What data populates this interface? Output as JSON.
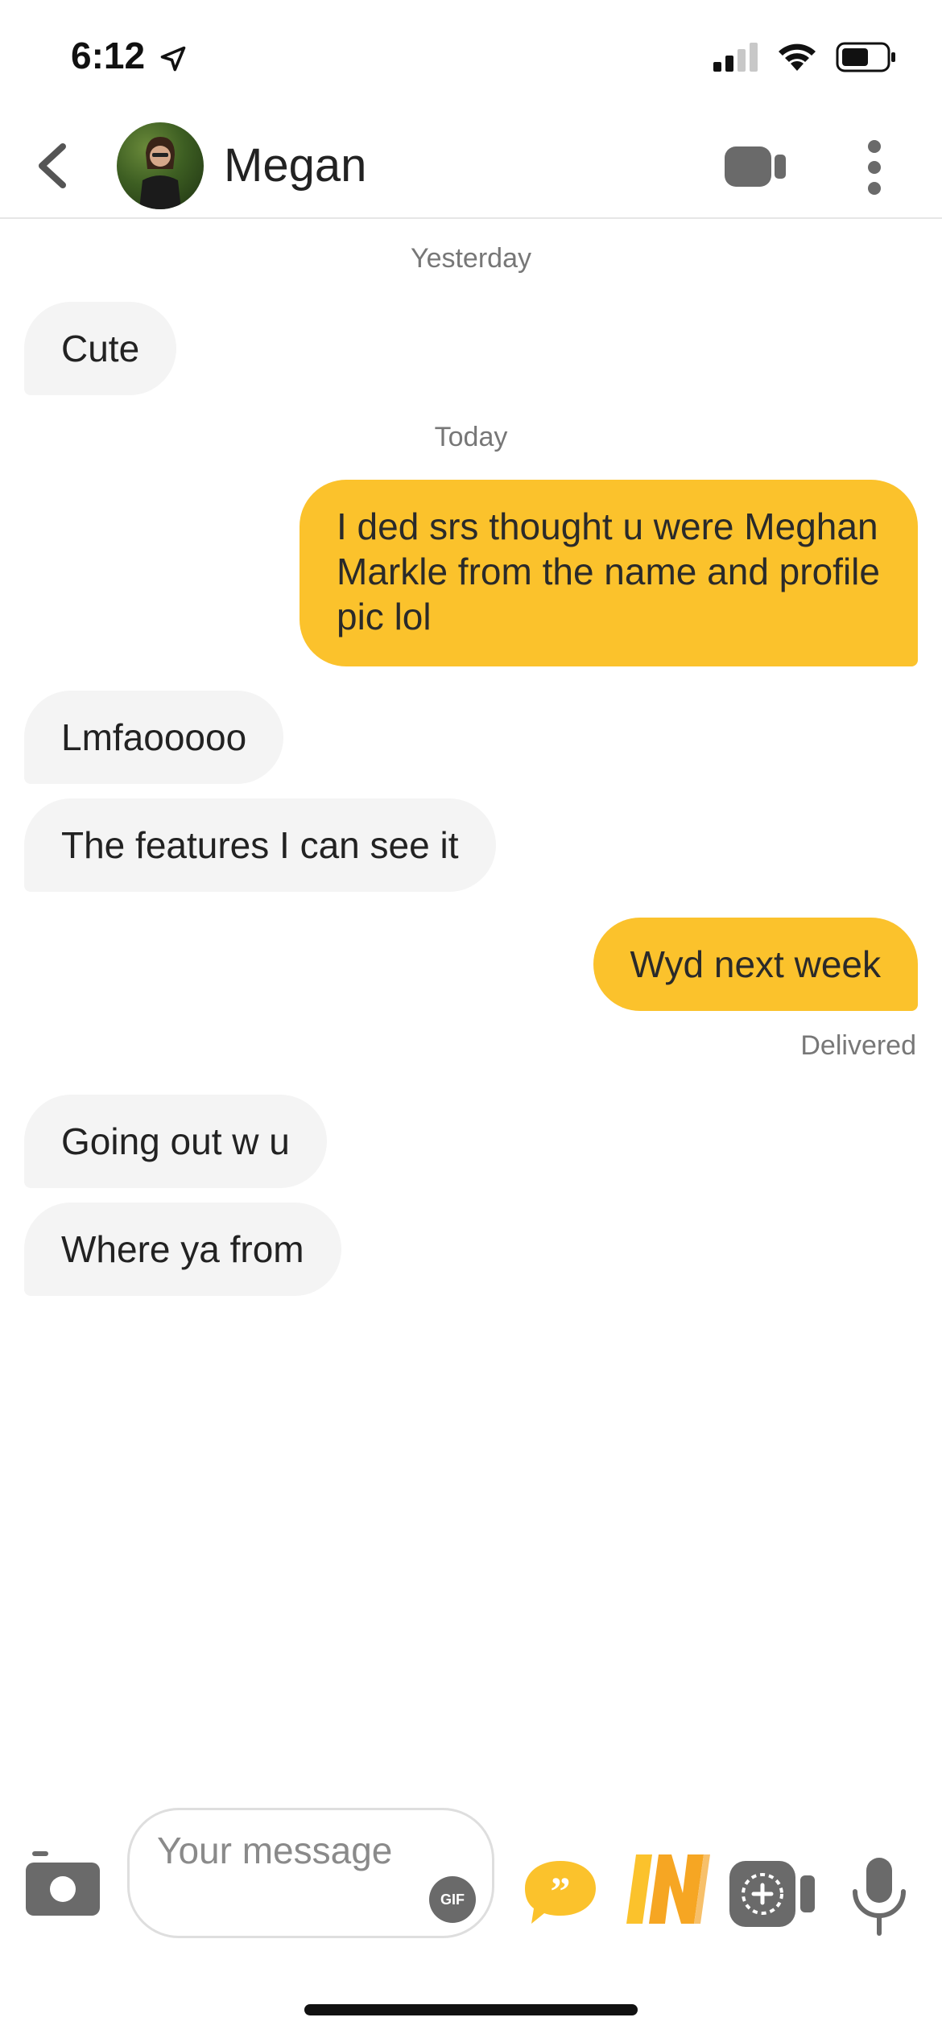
{
  "status_bar": {
    "time": "6:12"
  },
  "header": {
    "contact_name": "Megan"
  },
  "messages": [
    {
      "type": "date",
      "text": "Yesterday"
    },
    {
      "type": "in",
      "text": "Cute"
    },
    {
      "type": "date",
      "text": "Today"
    },
    {
      "type": "out",
      "text": "I ded srs thought u were Meghan Markle from the name and profile pic lol"
    },
    {
      "type": "in",
      "text": "Lmfaooooo"
    },
    {
      "type": "in",
      "text": "The features I can see it"
    },
    {
      "type": "out",
      "text": "Wyd next week"
    },
    {
      "type": "status",
      "text": "Delivered"
    },
    {
      "type": "in",
      "text": "Going out w u"
    },
    {
      "type": "in",
      "text": "Where ya from"
    }
  ],
  "composer": {
    "placeholder": "Your message",
    "gif_label": "GIF"
  },
  "colors": {
    "accent": "#fbc22c",
    "incoming_bubble": "#f4f4f4",
    "icon_gray": "#6a6a6a"
  },
  "icons": [
    "location-arrow-icon",
    "cellular-icon",
    "wifi-icon",
    "battery-icon",
    "back-chevron-icon",
    "video-camera-icon",
    "more-vertical-icon",
    "camera-icon",
    "gif-icon",
    "quote-icon",
    "in-icon",
    "add-video-icon",
    "microphone-icon"
  ]
}
